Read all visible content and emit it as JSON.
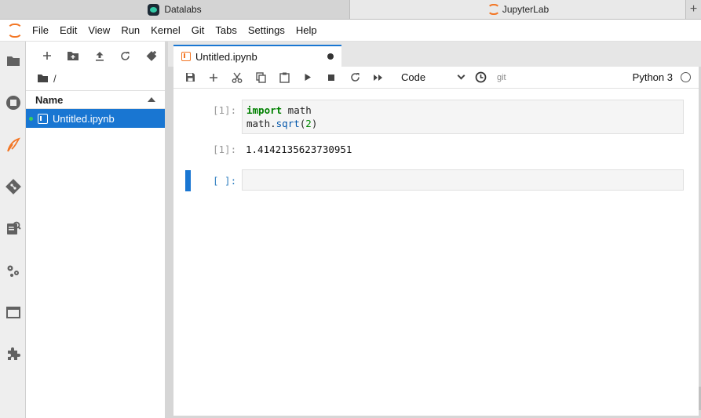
{
  "browser": {
    "tabs": [
      {
        "label": "Datalabs",
        "icon": "datalabs-logo-icon"
      },
      {
        "label": "JupyterLab",
        "icon": "jupyter-logo-icon"
      }
    ],
    "new_tab": "+"
  },
  "menu": {
    "items": [
      "File",
      "Edit",
      "View",
      "Run",
      "Kernel",
      "Git",
      "Tabs",
      "Settings",
      "Help"
    ]
  },
  "activity_bar": {
    "icons": [
      "folder-icon",
      "running-icon",
      "git-plugin-icon",
      "git-icon",
      "commands-icon",
      "property-inspector-icon",
      "tabs-icon",
      "extensions-icon"
    ]
  },
  "file_browser": {
    "path": "/",
    "column_header": "Name",
    "files": [
      {
        "name": "Untitled.ipynb",
        "selected": true,
        "running": true
      }
    ]
  },
  "notebook": {
    "tab_title": "Untitled.ipynb",
    "cell_type": "Code",
    "git_label": "git",
    "kernel": "Python 3",
    "cells": [
      {
        "prompt": "[1]:",
        "code_line1_kw": "import",
        "code_line1_rest": " math",
        "code_line2_obj": "math.",
        "code_line2_fn": "sqrt",
        "code_line2_open": "(",
        "code_line2_num": "2",
        "code_line2_close": ")",
        "output_prompt": "[1]:",
        "output": "1.4142135623730951"
      },
      {
        "prompt": "[ ]:",
        "code": ""
      }
    ]
  },
  "colors": {
    "accent": "#1976d2",
    "jupyter_orange": "#f37726",
    "keyword_green": "#008000"
  }
}
